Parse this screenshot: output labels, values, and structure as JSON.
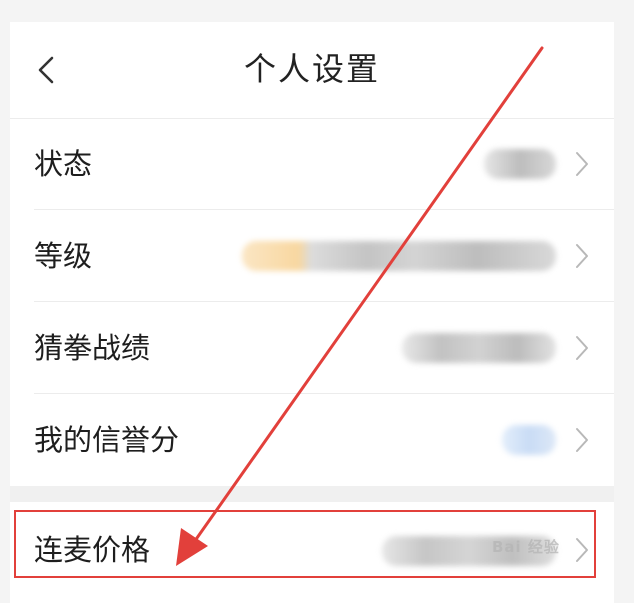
{
  "header": {
    "title": "个人设置",
    "back_icon": "chevron-left-icon"
  },
  "settings": {
    "items": [
      {
        "label": "状态"
      },
      {
        "label": "等级"
      },
      {
        "label": "猜拳战绩"
      },
      {
        "label": "我的信誉分"
      },
      {
        "label": "连麦价格"
      }
    ]
  },
  "colors": {
    "highlight": "#e2403b",
    "arrow": "#e2403b",
    "divider": "#ececec",
    "text": "#1e1e1e"
  },
  "watermark": {
    "text": "Bai 经验"
  }
}
